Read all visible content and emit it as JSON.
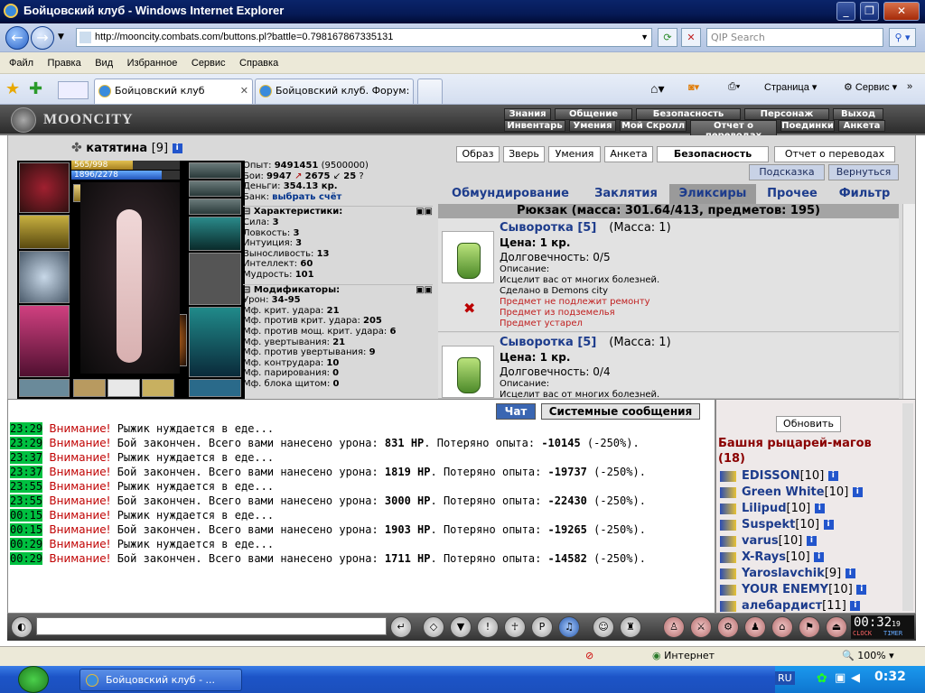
{
  "window": {
    "title": "Бойцовский клуб - Windows Internet Explorer"
  },
  "address": {
    "url": "http://mooncity.combats.com/buttons.pl?battle=0.798167867335131",
    "search_placeholder": "QIP Search"
  },
  "menu": [
    "Файл",
    "Правка",
    "Вид",
    "Избранное",
    "Сервис",
    "Справка"
  ],
  "tabs": [
    {
      "label": "Бойцовский клуб"
    },
    {
      "label": "Бойцовский клуб. Форум: \"..."
    }
  ],
  "ie_toolbar": {
    "page": "Страница",
    "service": "Сервис"
  },
  "game_nav": {
    "logo": "MOONCITY",
    "row1": [
      "Знания",
      "Общение",
      "Безопасность",
      "Персонаж",
      "Выход"
    ],
    "row2": [
      "Инвентарь",
      "Умения",
      "Мой Скролл",
      "Отчет о переводах",
      "Поединки",
      "Анкета"
    ]
  },
  "character": {
    "name": "катятина",
    "level": "[9]",
    "hp": "565/998",
    "hp_fraction": 0.566,
    "mp": "1896/2278",
    "mp_fraction": 0.832
  },
  "stats": {
    "exp_label": "Опыт:",
    "exp": "9491451",
    "exp_next": "(9500000)",
    "fights_label": "Бои:",
    "wins": "9947",
    "losses": "2675",
    "draws": "25",
    "money_label": "Деньги:",
    "money": "354.13 кр.",
    "bank_label": "Банк:",
    "bank_link": "выбрать счёт",
    "char_header": "Характеристики:",
    "attributes": [
      {
        "k": "Сила:",
        "v": "3"
      },
      {
        "k": "Ловкость:",
        "v": "3"
      },
      {
        "k": "Интуиция:",
        "v": "3"
      },
      {
        "k": "Выносливость:",
        "v": "13"
      },
      {
        "k": "Интеллект:",
        "v": "60"
      },
      {
        "k": "Мудрость:",
        "v": "101"
      }
    ],
    "mod_header": "Модификаторы:",
    "modifiers": [
      {
        "k": "Урон:",
        "v": "34-95"
      },
      {
        "k": "Мф. крит. удара:",
        "v": "21"
      },
      {
        "k": "Мф. против крит. удара:",
        "v": "205"
      },
      {
        "k": "Мф. против мощ. крит. удара:",
        "v": "6"
      },
      {
        "k": "Мф. увертывания:",
        "v": "21"
      },
      {
        "k": "Мф. против увертывания:",
        "v": "9"
      },
      {
        "k": "Мф. контрудара:",
        "v": "10"
      },
      {
        "k": "Мф. парирования:",
        "v": "0"
      },
      {
        "k": "Мф. блока щитом:",
        "v": "0"
      }
    ]
  },
  "top_buttons": [
    "Образ",
    "Зверь",
    "Умения",
    "Анкета",
    "Безопасность",
    "Отчет о переводах"
  ],
  "sub_buttons": [
    "Подсказка",
    "Вернуться"
  ],
  "inventory": {
    "tabs": [
      "Обмундирование",
      "Заклятия",
      "Эликсиры",
      "Прочее",
      "Фильтр"
    ],
    "active_tab": "Эликсиры",
    "header": "Рюкзак (масса: 301.64/413, предметов: 195)",
    "items": [
      {
        "name": "Сыворотка [5]",
        "mass": "(Масса: 1)",
        "price": "Цена: 1 кр.",
        "durability": "Долговечность: 0/5",
        "desc_label": "Описание:",
        "desc": "Исцелит вас от многих болезней.",
        "made": "Сделано в Demons city",
        "warnings": [
          "Предмет не подлежит ремонту",
          "Предмет из подземелья",
          "Предмет устарел"
        ]
      },
      {
        "name": "Сыворотка [5]",
        "mass": "(Масса: 1)",
        "price": "Цена: 1 кр.",
        "durability": "Долговечность: 0/4",
        "desc_label": "Описание:",
        "desc": "Исцелит вас от многих болезней."
      }
    ]
  },
  "chat": {
    "tabs": [
      "Чат",
      "Системные сообщения"
    ],
    "lines": [
      {
        "time": "23:29",
        "warn": "Внимание!",
        "text": " Рыжик нуждается в еде..."
      },
      {
        "time": "23:29",
        "warn": "Внимание!",
        "text": " Бой закончен. Всего вами нанесено урона: ",
        "dmg": "831 HP",
        "t2": ". Потеряно опыта: ",
        "lost": "-10145",
        "pct": " (-250%)."
      },
      {
        "time": "23:37",
        "warn": "Внимание!",
        "text": " Рыжик нуждается в еде..."
      },
      {
        "time": "23:37",
        "warn": "Внимание!",
        "text": " Бой закончен. Всего вами нанесено урона: ",
        "dmg": "1819 HP",
        "t2": ". Потеряно опыта: ",
        "lost": "-19737",
        "pct": " (-250%)."
      },
      {
        "time": "23:55",
        "warn": "Внимание!",
        "text": " Рыжик нуждается в еде..."
      },
      {
        "time": "23:55",
        "warn": "Внимание!",
        "text": " Бой закончен. Всего вами нанесено урона: ",
        "dmg": "3000 HP",
        "t2": ". Потеряно опыта: ",
        "lost": "-22430",
        "pct": " (-250%)."
      },
      {
        "time": "00:15",
        "warn": "Внимание!",
        "text": " Рыжик нуждается в еде..."
      },
      {
        "time": "00:15",
        "warn": "Внимание!",
        "text": " Бой закончен. Всего вами нанесено урона: ",
        "dmg": "1903 HP",
        "t2": ". Потеряно опыта: ",
        "lost": "-19265",
        "pct": " (-250%)."
      },
      {
        "time": "00:29",
        "warn": "Внимание!",
        "text": " Рыжик нуждается в еде..."
      },
      {
        "time": "00:29",
        "warn": "Внимание!",
        "text": " Бой закончен. Всего вами нанесено урона: ",
        "dmg": "1711 HP",
        "t2": ". Потеряно опыта: ",
        "lost": "-14582",
        "pct": " (-250%)."
      }
    ]
  },
  "online": {
    "refresh": "Обновить",
    "room": "Башня рыцарей-магов (18)",
    "users": [
      {
        "name": "EDISSON",
        "lvl": "[10]"
      },
      {
        "name": "Green White",
        "lvl": "[10]"
      },
      {
        "name": "Lilipud",
        "lvl": "[10]"
      },
      {
        "name": "Suspekt",
        "lvl": "[10]"
      },
      {
        "name": "varus",
        "lvl": "[10]"
      },
      {
        "name": "X-Rays",
        "lvl": "[10]"
      },
      {
        "name": "Yaroslavchik",
        "lvl": "[9]"
      },
      {
        "name": "YOUR ENEMY",
        "lvl": "[10]"
      },
      {
        "name": "алебардист",
        "lvl": "[11]"
      }
    ]
  },
  "clock": {
    "time": "00:32",
    "seconds": "19",
    "clock_label": "CLOCK",
    "timer_label": "TIMER"
  },
  "status": {
    "zone": "Интернет",
    "zoom": "100%"
  },
  "taskbar": {
    "task": "Бойцовский клуб - ...",
    "lang": "RU",
    "time": "0:32"
  }
}
